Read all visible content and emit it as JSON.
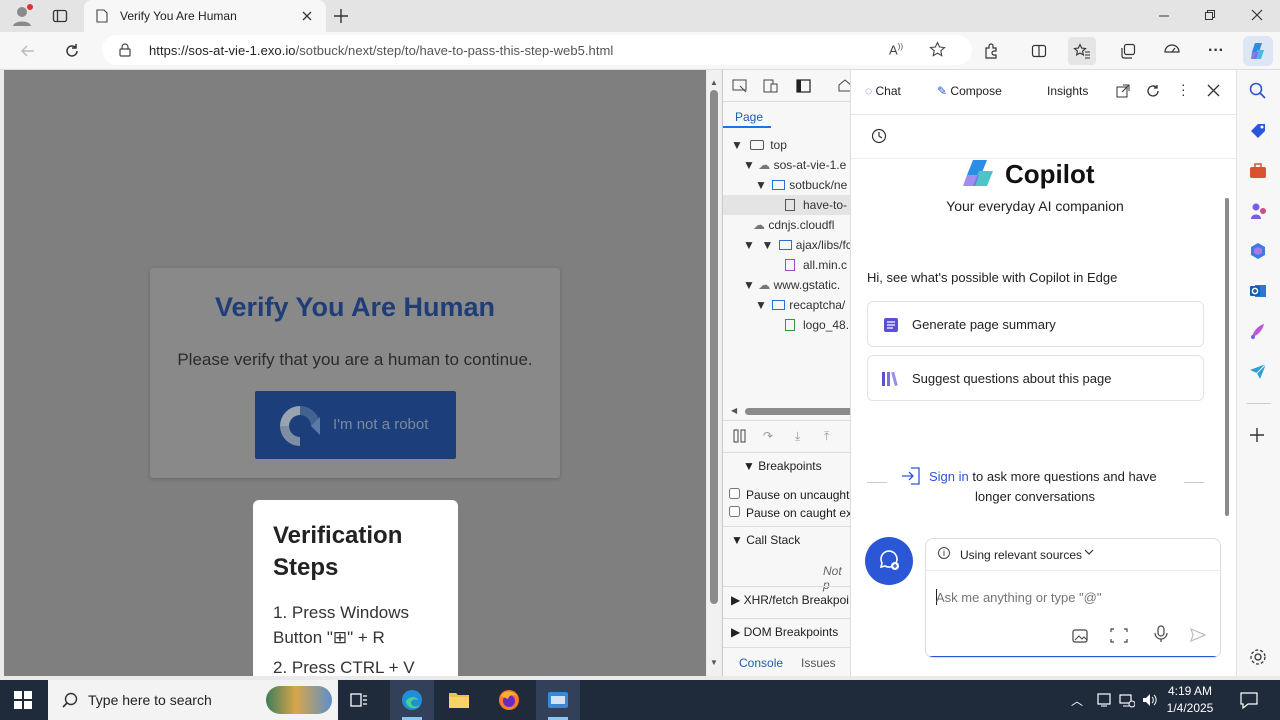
{
  "browser": {
    "tab_title": "Verify You Are Human",
    "url_host": "https://sos-at-vie-1.exo.io",
    "url_path": "/sotbuck/next/step/to/have-to-pass-this-step-web5.html"
  },
  "page": {
    "heading": "Verify You Are Human",
    "subtitle": "Please verify that you are a human to continue.",
    "captcha_label": "I'm not a robot",
    "steps_title": "Verification Steps",
    "step1": "1. Press Windows Button \"⊞\" + R",
    "step2": "2. Press CTRL + V"
  },
  "devtools": {
    "page_tab": "Page",
    "tree": [
      "top",
      "sos-at-vie-1.e",
      "sotbuck/ne",
      "have-to-",
      "cdnjs.cloudfl",
      "ajax/libs/fc",
      "all.min.c",
      "www.gstatic.",
      "recaptcha/",
      "logo_48."
    ],
    "breakpoints": "Breakpoints",
    "pause_uncaught": "Pause on uncaught",
    "pause_caught": "Pause on caught ex",
    "call_stack": "Call Stack",
    "not_paused": "Not p",
    "xhr": "XHR/fetch Breakpoi",
    "dom": "DOM Breakpoints",
    "console_tab": "Console",
    "issues_tab": "Issues"
  },
  "copilot": {
    "tab_chat": "Chat",
    "tab_compose": "Compose",
    "tab_insights": "Insights",
    "brand": "Copilot",
    "tagline": "Your everyday AI companion",
    "intro": "Hi, see what's possible with Copilot in Edge",
    "suggestion1": "Generate page summary",
    "suggestion2": "Suggest questions about this page",
    "signin_link": "Sign in",
    "signin_rest": "to ask more questions and have",
    "signin_rest2": "longer conversations",
    "sources": "Using relevant sources",
    "input_placeholder": "Ask me anything or type \"@\""
  },
  "taskbar": {
    "search_placeholder": "Type here to search",
    "time": "4:19 AM",
    "date": "1/4/2025"
  },
  "colors": {
    "heading": "#1f3d78",
    "captcha_bg": "#1c3f7c",
    "copilot_accent": "#2b57d6",
    "taskbar": "#1f2a3a"
  }
}
